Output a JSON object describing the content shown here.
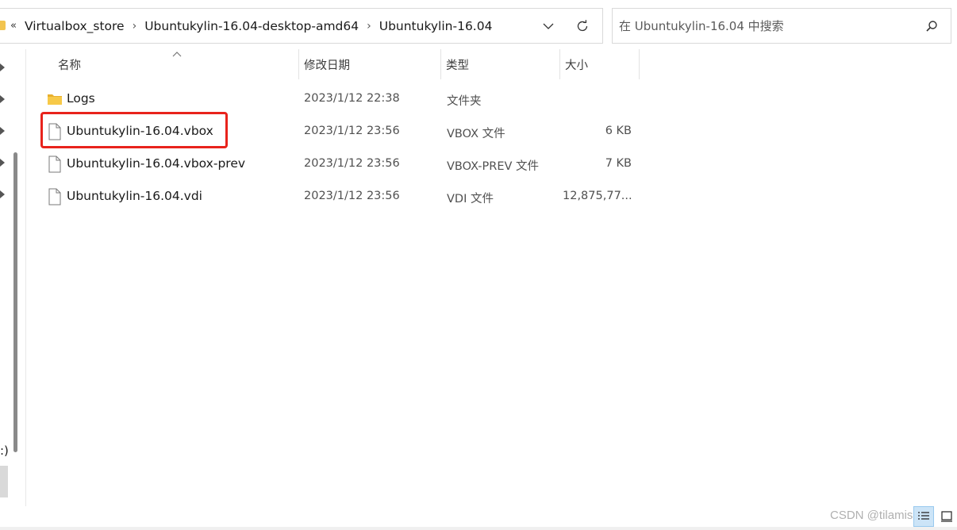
{
  "address_bar": {
    "overflow": "«",
    "crumbs": [
      "Virtualbox_store",
      "Ubuntukylin-16.04-desktop-amd64",
      "Ubuntukylin-16.04"
    ]
  },
  "search": {
    "placeholder": "在 Ubuntukylin-16.04 中搜索",
    "value": ""
  },
  "nav": {
    "partial_label": ":)"
  },
  "columns": {
    "name": "名称",
    "date": "修改日期",
    "type": "类型",
    "size": "大小"
  },
  "files": [
    {
      "icon": "folder-icon",
      "name": "Logs",
      "date": "2023/1/12 22:38",
      "type": "文件夹",
      "size": ""
    },
    {
      "icon": "file-icon",
      "name": "Ubuntukylin-16.04.vbox",
      "date": "2023/1/12 23:56",
      "type": "VBOX 文件",
      "size": "6 KB"
    },
    {
      "icon": "file-icon",
      "name": "Ubuntukylin-16.04.vbox-prev",
      "date": "2023/1/12 23:56",
      "type": "VBOX-PREV 文件",
      "size": "7 KB"
    },
    {
      "icon": "file-icon",
      "name": "Ubuntukylin-16.04.vdi",
      "date": "2023/1/12 23:56",
      "type": "VDI 文件",
      "size": "12,875,77..."
    }
  ],
  "watermark": "CSDN @tilamisu",
  "colors": {
    "highlight": "#e8231c",
    "folder": "#f2c44f",
    "selection": "#cce4f7"
  }
}
